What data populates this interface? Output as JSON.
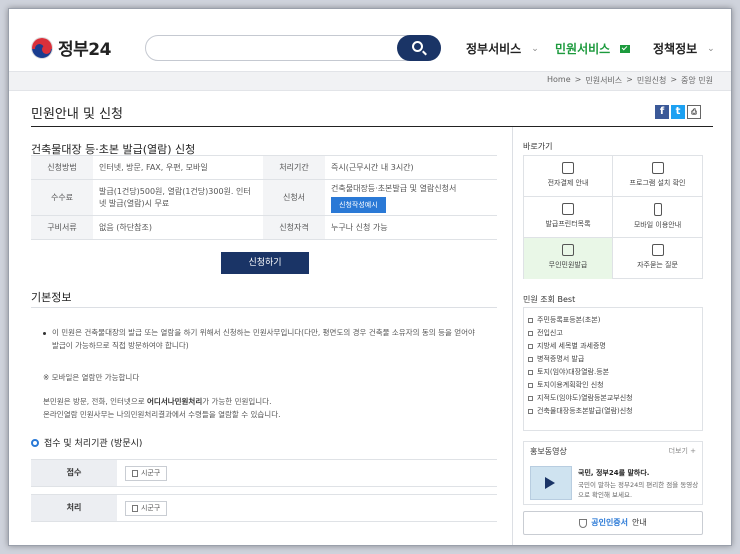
{
  "header": {
    "logo_text": "정부24",
    "search_placeholder": "",
    "nav": [
      {
        "label": "정부서비스",
        "active": false
      },
      {
        "label": "민원서비스",
        "active": true
      },
      {
        "label": "정책정보",
        "active": false
      }
    ]
  },
  "breadcrumb": [
    "Home",
    "민원서비스",
    "민원신청",
    "중앙 민원"
  ],
  "page_title": "민원안내 및 신청",
  "share": {
    "facebook": "f",
    "twitter": "t",
    "print": "⎙"
  },
  "service": {
    "title": "건축물대장 등·초본 발급(열람) 신청",
    "rows": [
      {
        "h1": "신청방법",
        "v1": "인터넷, 방문, FAX, 우편, 모바일",
        "h2": "처리기간",
        "v2": "즉시(근무시간 내 3시간)"
      },
      {
        "h1": "수수료",
        "v1": "발급(1건당)500원, 열람(1건당)300원. 인터넷 발급(열람)시 무료",
        "h2": "신청서",
        "v2": "건축물대장등·초본발급 및 열람신청서",
        "form_button": "신청작성예시"
      },
      {
        "h1": "구비서류",
        "v1": "없음 (하단참조)",
        "h2": "신청자격",
        "v2": "누구나 신청 가능"
      }
    ],
    "apply_button": "신청하기"
  },
  "basic_info": {
    "title": "기본정보",
    "paragraph1_line1": "이 민원은 건축물대장의 발급 또는 열람을 하기 위해서 신청하는 민원사무입니다(다만, 평면도의 경우 건축물 소유자의 동의 등을 얻어야",
    "paragraph1_line2": "발급이 가능하므로 직접 방문하여야 합니다)",
    "note": "※ 모바일은 열람만 가능합니다",
    "paragraph2_line1_pre": "본민원은 방문, 전화, 인터넷으로 ",
    "paragraph2_line1_bold": "어디서나민원처리",
    "paragraph2_line1_post": "가 가능한 민원입니다.",
    "paragraph2_line2": "온라인열람 민원사무는 나의민원처리결과에서 수령들을 열람할 수 있습니다."
  },
  "processing": {
    "title": "접수 및 처리기관 (방문시)",
    "rows": [
      {
        "label": "접수",
        "tag": "시군구"
      },
      {
        "label": "처리",
        "tag": "시군구"
      }
    ]
  },
  "sidebar": {
    "shortcuts_title": "바로가기",
    "shortcuts": [
      {
        "label": "전자결제 안내",
        "icon": "download-icon",
        "highlight": false
      },
      {
        "label": "프로그램 설치 확인",
        "icon": "monitor-icon",
        "highlight": false
      },
      {
        "label": "발급프린터목록",
        "icon": "printer-icon",
        "highlight": false
      },
      {
        "label": "모바일 이용안내",
        "icon": "mobile-icon",
        "highlight": false
      },
      {
        "label": "무인민원발급",
        "icon": "kiosk-icon",
        "highlight": true
      },
      {
        "label": "자주묻는 질문",
        "icon": "chat-icon",
        "highlight": false
      }
    ],
    "best_title": "민원 조회 Best",
    "best_items": [
      "주민등록표등본(초본)",
      "전입신고",
      "지방세 세목별 과세증명",
      "병적증명서 발급",
      "토지(임야)대장열람.등본",
      "토지이용계획확인 신청",
      "지적도(임야도)열람등본교부신청",
      "건축물대장등초본발급(열람)신청"
    ],
    "promo": {
      "title": "홍보동영상",
      "more": "더보기 +",
      "headline": "국민, 정부24를 말하다.",
      "description": "국민이 말하는 정부24의 편리한 점을 동영상으로 확인해 보세요."
    },
    "cert": {
      "highlight": "공인인증서",
      "rest": "안내"
    }
  }
}
